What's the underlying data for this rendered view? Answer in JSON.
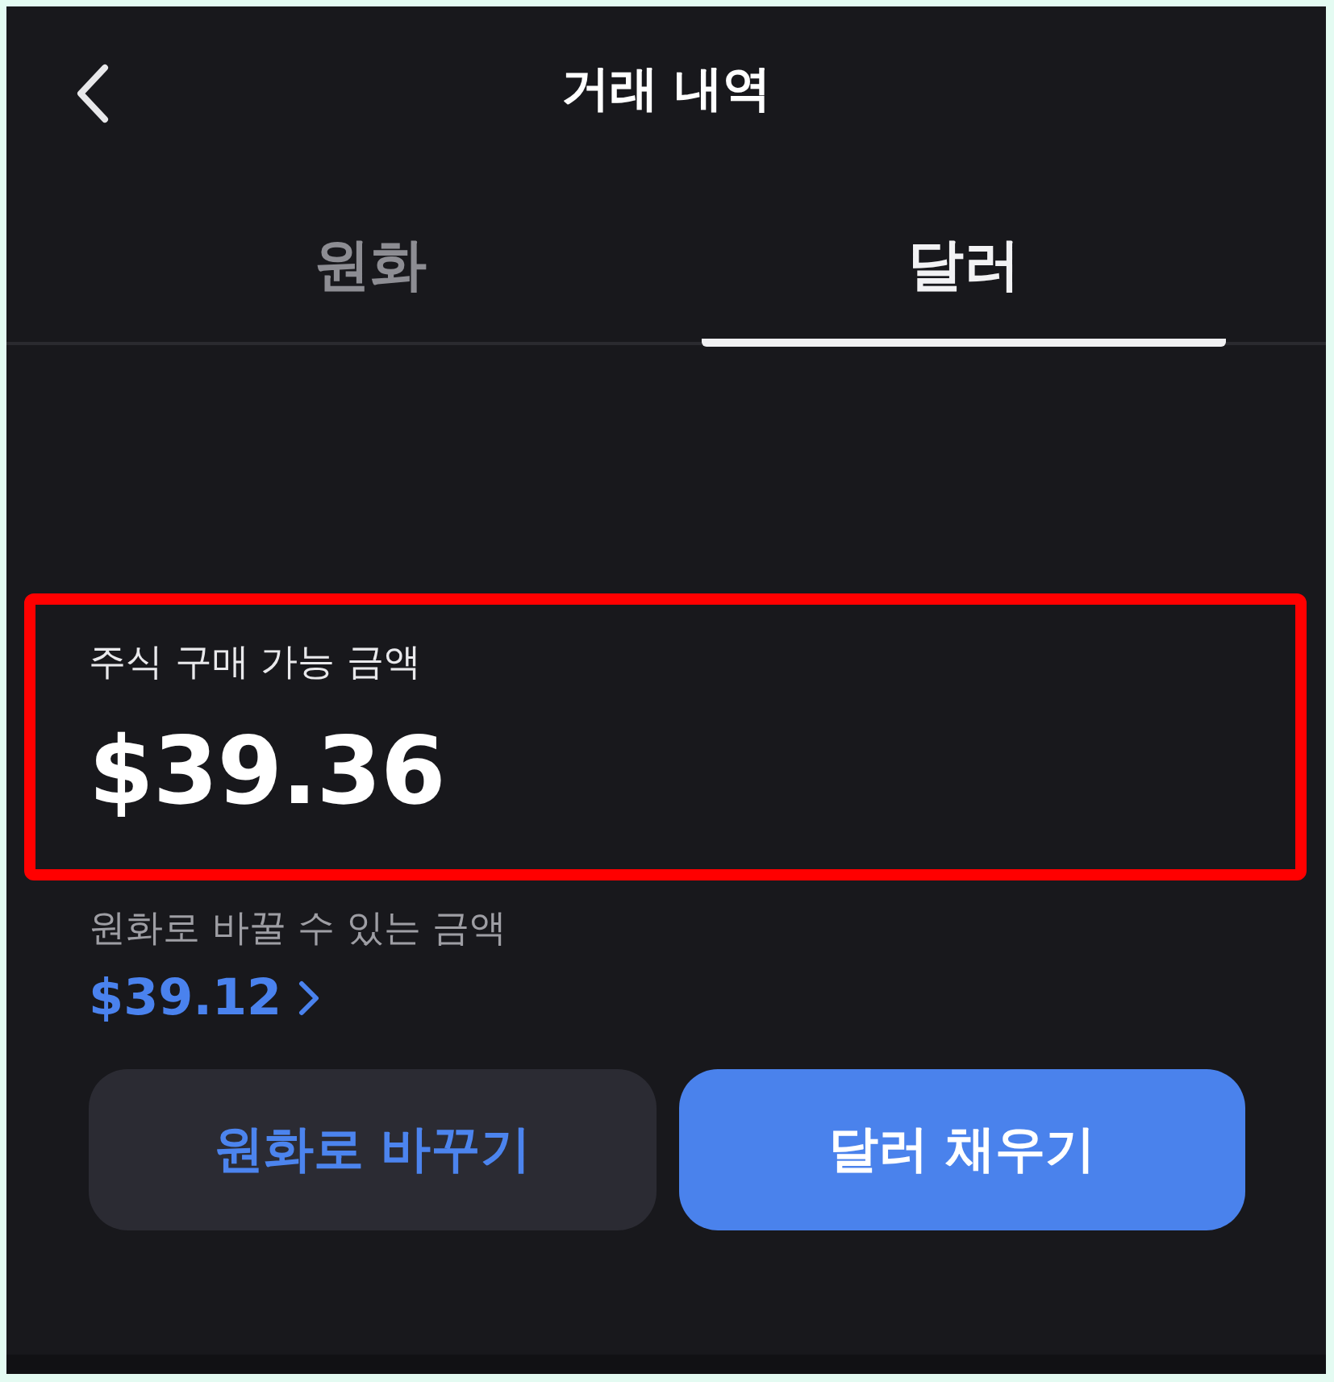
{
  "header": {
    "title": "거래 내역"
  },
  "tabs": [
    {
      "label": "원화",
      "selected": false
    },
    {
      "label": "달러",
      "selected": true
    }
  ],
  "balance": {
    "label": "주식 구매 가능 금액",
    "amount": "$39.36",
    "highlighted": true
  },
  "convertible": {
    "label": "원화로 바꿀 수 있는 금액",
    "amount": "$39.12"
  },
  "buttons": [
    {
      "label": "원화로 바꾸기",
      "kind": "secondary"
    },
    {
      "label": "달러 채우기",
      "kind": "primary"
    }
  ]
}
